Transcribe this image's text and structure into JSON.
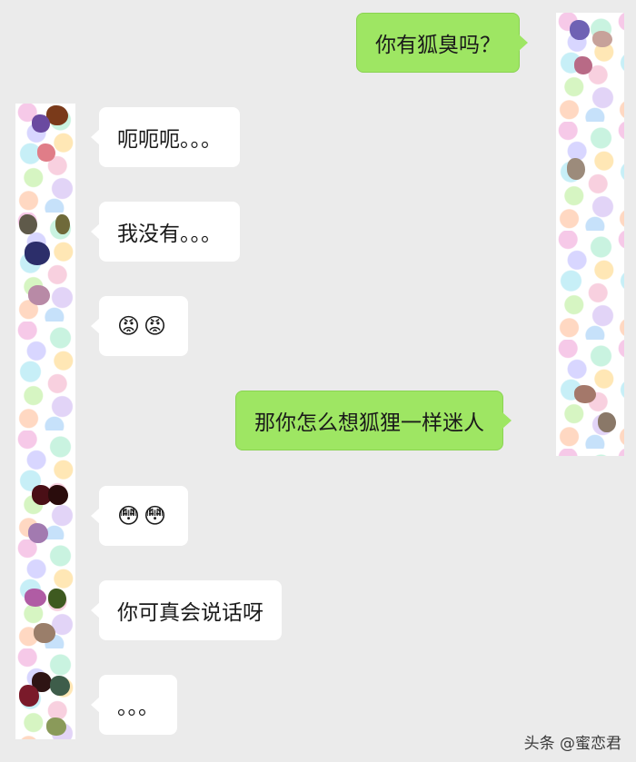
{
  "messages": [
    {
      "side": "out",
      "text": "你有狐臭吗？"
    },
    {
      "side": "in",
      "text": "呃呃呃。。。"
    },
    {
      "side": "in",
      "text": "我没有。。。"
    },
    {
      "side": "in",
      "text": "😡😡"
    },
    {
      "side": "out",
      "text": "那你怎么想狐狸一样迷人"
    },
    {
      "side": "in",
      "text": "😳😳"
    },
    {
      "side": "in",
      "text": "你可真会说话呀"
    },
    {
      "side": "in",
      "text": "。。。"
    }
  ],
  "watermark": "头条 @蜜恋君",
  "colors": {
    "background": "#ebebeb",
    "outgoing_bubble": "#9ee663",
    "incoming_bubble": "#ffffff"
  },
  "avatars": {
    "self": "mosaic-avatar-strip",
    "contact": "mosaic-avatar-strip"
  }
}
